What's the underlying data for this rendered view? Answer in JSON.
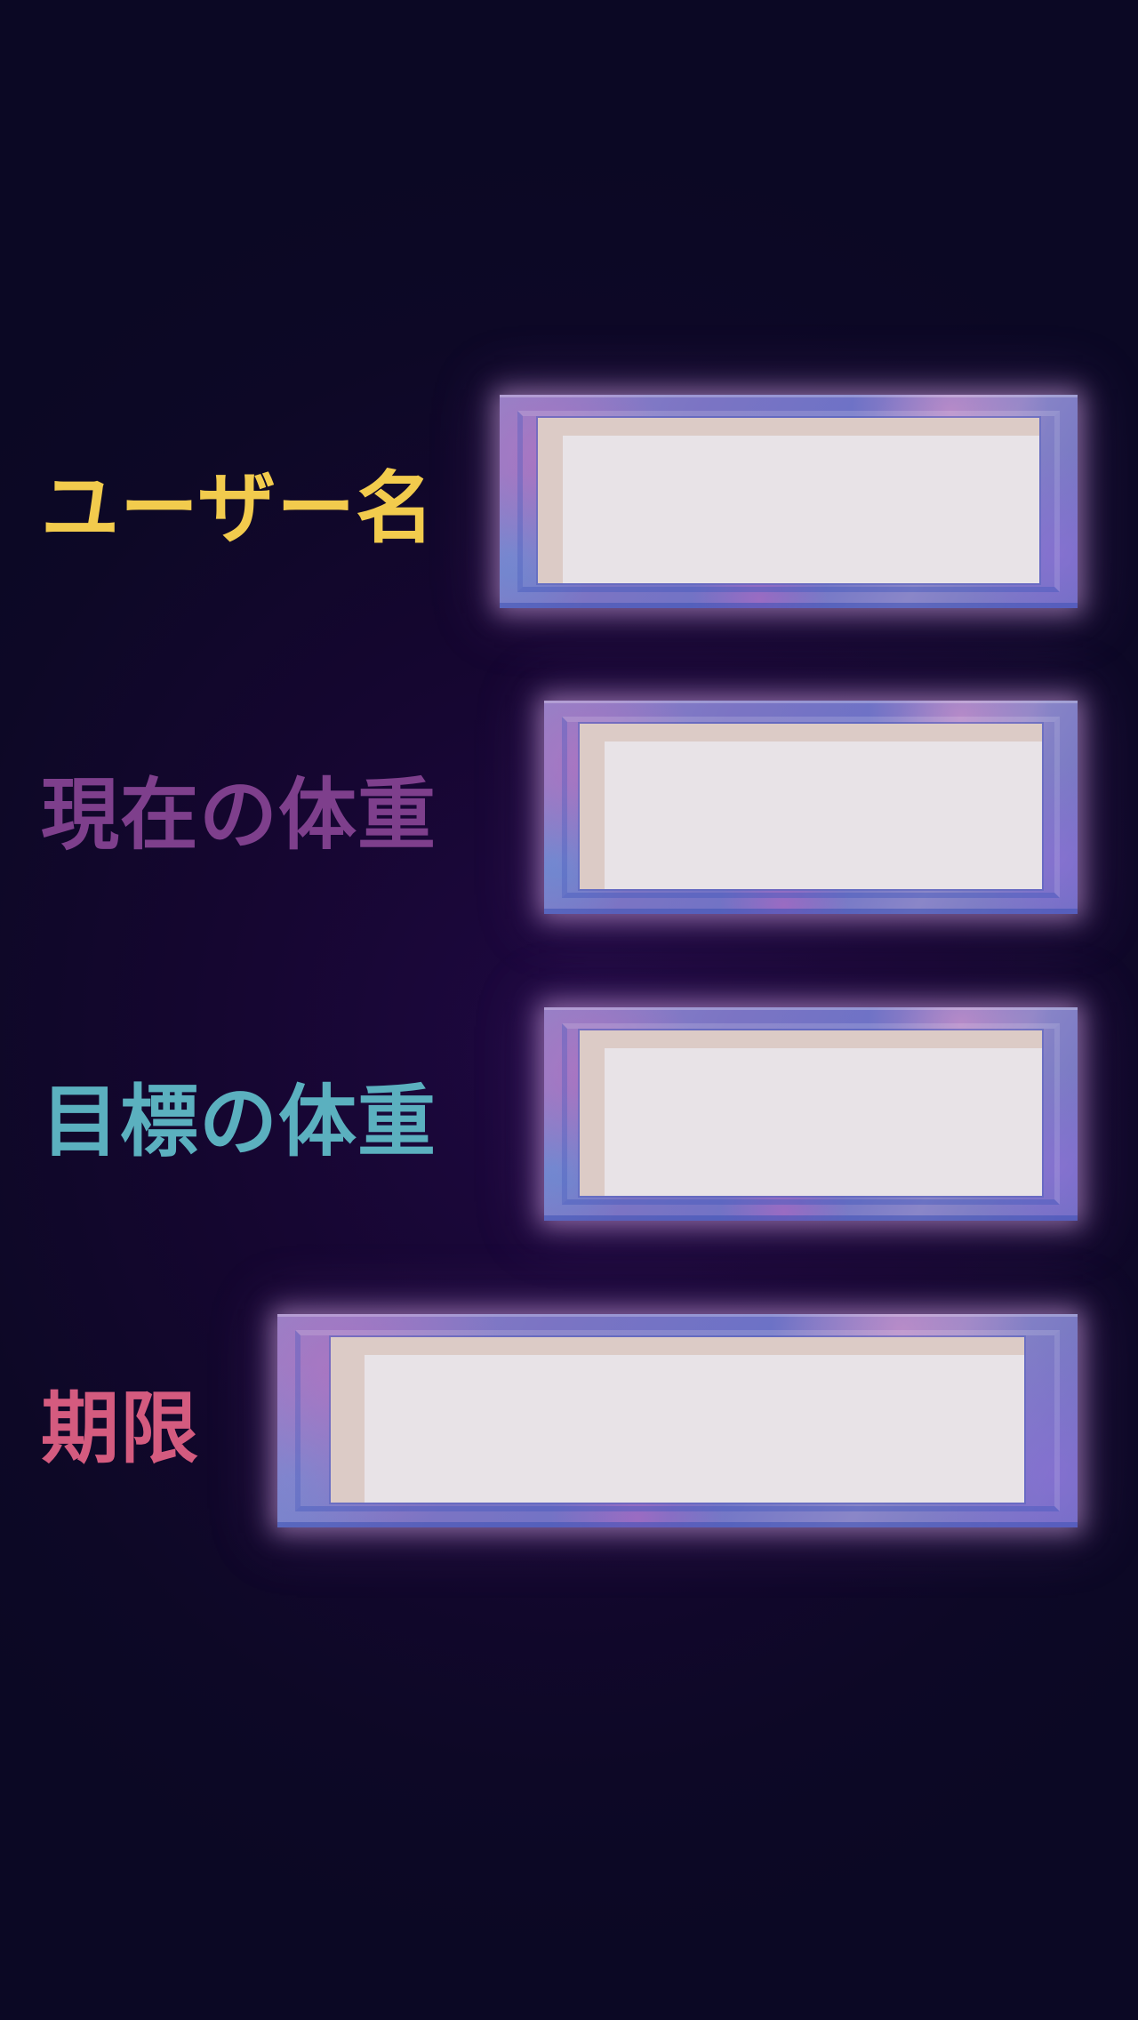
{
  "form": {
    "fields": [
      {
        "id": "username",
        "label": "ユーザー名",
        "label_color": "#f2cb4d",
        "value": ""
      },
      {
        "id": "current_weight",
        "label": "現在の体重",
        "label_color": "#7e3f8c",
        "value": ""
      },
      {
        "id": "target_weight",
        "label": "目標の体重",
        "label_color": "#5bb0bf",
        "value": ""
      },
      {
        "id": "deadline",
        "label": "期限",
        "label_color": "#d45b7f",
        "value": ""
      }
    ]
  },
  "theme": {
    "background": "#0d0826",
    "frame_color": "#7b74c4",
    "input_fill": "#e8e3e7"
  }
}
